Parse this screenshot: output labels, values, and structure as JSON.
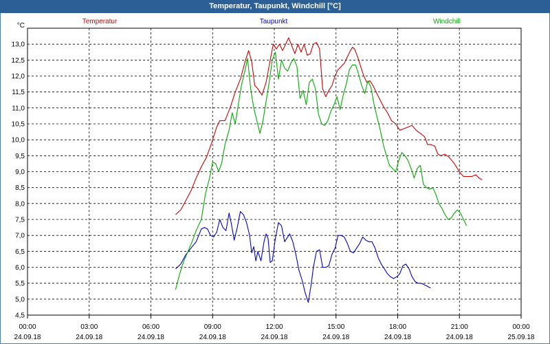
{
  "window": {
    "title": "Temperatur, Taupunkt, Windchill [°C]"
  },
  "chart_data": {
    "type": "line",
    "title": "Temperatur, Taupunkt, Windchill [°C]",
    "ylabel": "°C",
    "ylim": [
      4.5,
      13.5
    ],
    "yticks": [
      4.5,
      5.0,
      5.5,
      6.0,
      6.5,
      7.0,
      7.5,
      8.0,
      8.5,
      9.0,
      9.5,
      10.0,
      10.5,
      11.0,
      11.5,
      12.0,
      12.5,
      13.0
    ],
    "ytick_labels": [
      "4,5",
      "5,0",
      "5,5",
      "6,0",
      "6,5",
      "7,0",
      "7,5",
      "8,0",
      "8,5",
      "9,0",
      "9,5",
      "10,0",
      "10,5",
      "11,0",
      "11,5",
      "12,0",
      "12,5",
      "13,0"
    ],
    "xlim_hours": [
      0,
      24
    ],
    "xticks": [
      {
        "hour": 0,
        "time": "00:00",
        "date": "24.09.18"
      },
      {
        "hour": 3,
        "time": "03:00",
        "date": "24.09.18"
      },
      {
        "hour": 6,
        "time": "06:00",
        "date": "24.09.18"
      },
      {
        "hour": 9,
        "time": "09:00",
        "date": "24.09.18"
      },
      {
        "hour": 12,
        "time": "12:00",
        "date": "24.09.18"
      },
      {
        "hour": 15,
        "time": "15:00",
        "date": "24.09.18"
      },
      {
        "hour": 18,
        "time": "18:00",
        "date": "24.09.18"
      },
      {
        "hour": 21,
        "time": "21:00",
        "date": "24.09.18"
      },
      {
        "hour": 24,
        "time": "00:00",
        "date": "25.09.18"
      }
    ],
    "grid": true,
    "legend_position": "top",
    "series": [
      {
        "name": "Temperatur",
        "color": "#cc0000",
        "points": [
          [
            7.2,
            7.65
          ],
          [
            7.45,
            7.8
          ],
          [
            7.7,
            8.1
          ],
          [
            7.95,
            8.4
          ],
          [
            8.2,
            8.8
          ],
          [
            8.45,
            9.15
          ],
          [
            8.7,
            9.45
          ],
          [
            8.95,
            9.9
          ],
          [
            9.2,
            10.4
          ],
          [
            9.35,
            10.6
          ],
          [
            9.6,
            10.6
          ],
          [
            9.85,
            11.0
          ],
          [
            10.1,
            11.5
          ],
          [
            10.35,
            11.9
          ],
          [
            10.6,
            12.5
          ],
          [
            10.75,
            12.8
          ],
          [
            10.9,
            12.45
          ],
          [
            11.05,
            11.7
          ],
          [
            11.2,
            11.6
          ],
          [
            11.4,
            11.4
          ],
          [
            11.6,
            11.8
          ],
          [
            11.8,
            12.5
          ],
          [
            11.95,
            13.0
          ],
          [
            12.1,
            12.85
          ],
          [
            12.25,
            13.0
          ],
          [
            12.4,
            12.8
          ],
          [
            12.55,
            13.0
          ],
          [
            12.7,
            13.2
          ],
          [
            12.85,
            12.95
          ],
          [
            13.0,
            12.7
          ],
          [
            13.15,
            13.0
          ],
          [
            13.3,
            12.75
          ],
          [
            13.45,
            13.0
          ],
          [
            13.6,
            12.65
          ],
          [
            13.75,
            12.7
          ],
          [
            13.9,
            13.0
          ],
          [
            14.05,
            13.05
          ],
          [
            14.2,
            12.85
          ],
          [
            14.35,
            11.6
          ],
          [
            14.5,
            11.35
          ],
          [
            14.65,
            11.55
          ],
          [
            14.8,
            11.7
          ],
          [
            14.95,
            12.0
          ],
          [
            15.1,
            12.2
          ],
          [
            15.25,
            12.3
          ],
          [
            15.4,
            12.4
          ],
          [
            15.55,
            12.6
          ],
          [
            15.7,
            12.8
          ],
          [
            15.8,
            12.9
          ],
          [
            15.9,
            12.85
          ],
          [
            16.05,
            12.6
          ],
          [
            16.2,
            12.3
          ],
          [
            16.35,
            12.0
          ],
          [
            16.5,
            11.8
          ],
          [
            16.65,
            11.85
          ],
          [
            16.8,
            11.7
          ],
          [
            16.95,
            11.5
          ],
          [
            17.1,
            11.3
          ],
          [
            17.3,
            11.05
          ],
          [
            17.5,
            10.85
          ],
          [
            17.7,
            10.6
          ],
          [
            17.9,
            10.5
          ],
          [
            18.1,
            10.3
          ],
          [
            18.3,
            10.35
          ],
          [
            18.5,
            10.4
          ],
          [
            18.7,
            10.45
          ],
          [
            18.9,
            10.3
          ],
          [
            19.1,
            10.2
          ],
          [
            19.3,
            10.1
          ],
          [
            19.45,
            9.85
          ],
          [
            19.6,
            9.85
          ],
          [
            19.8,
            9.8
          ],
          [
            19.95,
            9.55
          ],
          [
            20.1,
            9.5
          ],
          [
            20.3,
            9.55
          ],
          [
            20.5,
            9.45
          ],
          [
            20.7,
            9.3
          ],
          [
            20.9,
            9.1
          ],
          [
            21.05,
            8.95
          ],
          [
            21.2,
            8.85
          ],
          [
            21.4,
            8.85
          ],
          [
            21.6,
            8.85
          ],
          [
            21.8,
            8.9
          ],
          [
            21.95,
            8.8
          ],
          [
            22.1,
            8.75
          ]
        ]
      },
      {
        "name": "Taupunkt",
        "color": "#0000cc",
        "points": [
          [
            7.2,
            5.95
          ],
          [
            7.45,
            6.1
          ],
          [
            7.7,
            6.4
          ],
          [
            7.95,
            6.6
          ],
          [
            8.2,
            6.8
          ],
          [
            8.45,
            7.2
          ],
          [
            8.6,
            7.25
          ],
          [
            8.75,
            7.2
          ],
          [
            8.9,
            7.0
          ],
          [
            9.05,
            6.95
          ],
          [
            9.2,
            7.1
          ],
          [
            9.35,
            7.5
          ],
          [
            9.5,
            7.25
          ],
          [
            9.65,
            7.15
          ],
          [
            9.8,
            7.7
          ],
          [
            9.9,
            7.4
          ],
          [
            10.05,
            6.85
          ],
          [
            10.2,
            7.25
          ],
          [
            10.35,
            7.75
          ],
          [
            10.5,
            7.65
          ],
          [
            10.65,
            7.4
          ],
          [
            10.8,
            7.0
          ],
          [
            10.9,
            6.45
          ],
          [
            11.0,
            6.65
          ],
          [
            11.1,
            6.2
          ],
          [
            11.2,
            6.5
          ],
          [
            11.35,
            6.2
          ],
          [
            11.5,
            6.8
          ],
          [
            11.6,
            7.05
          ],
          [
            11.7,
            6.9
          ],
          [
            11.8,
            6.15
          ],
          [
            11.9,
            6.2
          ],
          [
            12.05,
            6.9
          ],
          [
            12.2,
            7.4
          ],
          [
            12.35,
            7.3
          ],
          [
            12.5,
            6.8
          ],
          [
            12.6,
            6.9
          ],
          [
            12.75,
            7.05
          ],
          [
            12.9,
            6.8
          ],
          [
            13.05,
            6.4
          ],
          [
            13.2,
            5.9
          ],
          [
            13.35,
            5.6
          ],
          [
            13.5,
            5.2
          ],
          [
            13.65,
            4.9
          ],
          [
            13.8,
            5.5
          ],
          [
            13.9,
            6.0
          ],
          [
            14.05,
            6.5
          ],
          [
            14.2,
            6.55
          ],
          [
            14.35,
            6.0
          ],
          [
            14.5,
            6.0
          ],
          [
            14.65,
            6.05
          ],
          [
            14.8,
            6.4
          ],
          [
            14.95,
            6.6
          ],
          [
            15.1,
            7.0
          ],
          [
            15.25,
            7.0
          ],
          [
            15.4,
            6.95
          ],
          [
            15.55,
            6.75
          ],
          [
            15.7,
            6.5
          ],
          [
            15.85,
            6.45
          ],
          [
            16.0,
            6.6
          ],
          [
            16.15,
            6.75
          ],
          [
            16.3,
            6.95
          ],
          [
            16.45,
            6.85
          ],
          [
            16.6,
            6.8
          ],
          [
            16.75,
            6.8
          ],
          [
            16.9,
            6.6
          ],
          [
            17.05,
            6.3
          ],
          [
            17.2,
            6.1
          ],
          [
            17.35,
            5.95
          ],
          [
            17.5,
            5.8
          ],
          [
            17.65,
            5.7
          ],
          [
            17.8,
            5.65
          ],
          [
            17.95,
            5.7
          ],
          [
            18.1,
            5.8
          ],
          [
            18.25,
            6.05
          ],
          [
            18.4,
            6.1
          ],
          [
            18.55,
            5.95
          ],
          [
            18.7,
            5.7
          ],
          [
            18.85,
            5.55
          ],
          [
            19.0,
            5.5
          ],
          [
            19.15,
            5.5
          ],
          [
            19.3,
            5.45
          ],
          [
            19.45,
            5.4
          ],
          [
            19.6,
            5.35
          ]
        ]
      },
      {
        "name": "Windchill",
        "color": "#00aa00",
        "points": [
          [
            7.2,
            5.3
          ],
          [
            7.4,
            5.8
          ],
          [
            7.6,
            6.2
          ],
          [
            7.8,
            6.5
          ],
          [
            8.0,
            6.8
          ],
          [
            8.2,
            7.15
          ],
          [
            8.45,
            7.5
          ],
          [
            8.65,
            8.3
          ],
          [
            8.85,
            8.8
          ],
          [
            9.0,
            9.3
          ],
          [
            9.15,
            9.25
          ],
          [
            9.3,
            9.0
          ],
          [
            9.45,
            9.3
          ],
          [
            9.6,
            9.85
          ],
          [
            9.8,
            10.3
          ],
          [
            9.95,
            10.85
          ],
          [
            10.1,
            10.5
          ],
          [
            10.25,
            11.1
          ],
          [
            10.4,
            11.7
          ],
          [
            10.55,
            12.1
          ],
          [
            10.7,
            12.55
          ],
          [
            10.85,
            11.6
          ],
          [
            11.0,
            11.0
          ],
          [
            11.15,
            10.6
          ],
          [
            11.3,
            10.2
          ],
          [
            11.45,
            10.6
          ],
          [
            11.6,
            11.2
          ],
          [
            11.75,
            11.8
          ],
          [
            11.9,
            12.5
          ],
          [
            12.05,
            12.75
          ],
          [
            12.2,
            11.9
          ],
          [
            12.35,
            12.5
          ],
          [
            12.5,
            12.25
          ],
          [
            12.65,
            12.15
          ],
          [
            12.8,
            12.4
          ],
          [
            12.95,
            12.55
          ],
          [
            13.1,
            12.3
          ],
          [
            13.25,
            11.3
          ],
          [
            13.4,
            11.55
          ],
          [
            13.55,
            11.1
          ],
          [
            13.7,
            11.8
          ],
          [
            13.85,
            11.9
          ],
          [
            14.0,
            11.6
          ],
          [
            14.15,
            10.8
          ],
          [
            14.3,
            10.5
          ],
          [
            14.45,
            10.45
          ],
          [
            14.6,
            10.6
          ],
          [
            14.75,
            10.9
          ],
          [
            14.9,
            11.1
          ],
          [
            15.05,
            11.35
          ],
          [
            15.2,
            10.95
          ],
          [
            15.35,
            11.4
          ],
          [
            15.5,
            11.75
          ],
          [
            15.65,
            12.2
          ],
          [
            15.8,
            12.35
          ],
          [
            15.95,
            12.35
          ],
          [
            16.1,
            12.05
          ],
          [
            16.25,
            11.7
          ],
          [
            16.4,
            11.45
          ],
          [
            16.55,
            11.85
          ],
          [
            16.7,
            11.65
          ],
          [
            16.85,
            11.1
          ],
          [
            17.0,
            10.7
          ],
          [
            17.15,
            10.3
          ],
          [
            17.3,
            9.85
          ],
          [
            17.45,
            9.5
          ],
          [
            17.6,
            9.2
          ],
          [
            17.75,
            9.1
          ],
          [
            17.9,
            9.0
          ],
          [
            18.05,
            9.35
          ],
          [
            18.2,
            9.6
          ],
          [
            18.35,
            9.5
          ],
          [
            18.5,
            9.35
          ],
          [
            18.65,
            9.1
          ],
          [
            18.8,
            8.8
          ],
          [
            18.95,
            9.1
          ],
          [
            19.1,
            9.2
          ],
          [
            19.25,
            8.6
          ],
          [
            19.4,
            8.5
          ],
          [
            19.55,
            8.45
          ],
          [
            19.7,
            8.5
          ],
          [
            19.85,
            8.3
          ],
          [
            20.0,
            8.0
          ],
          [
            20.15,
            7.85
          ],
          [
            20.3,
            7.65
          ],
          [
            20.45,
            7.5
          ],
          [
            20.6,
            7.55
          ],
          [
            20.75,
            7.7
          ],
          [
            20.9,
            7.8
          ],
          [
            21.05,
            7.7
          ],
          [
            21.2,
            7.5
          ],
          [
            21.35,
            7.3
          ]
        ]
      }
    ]
  }
}
